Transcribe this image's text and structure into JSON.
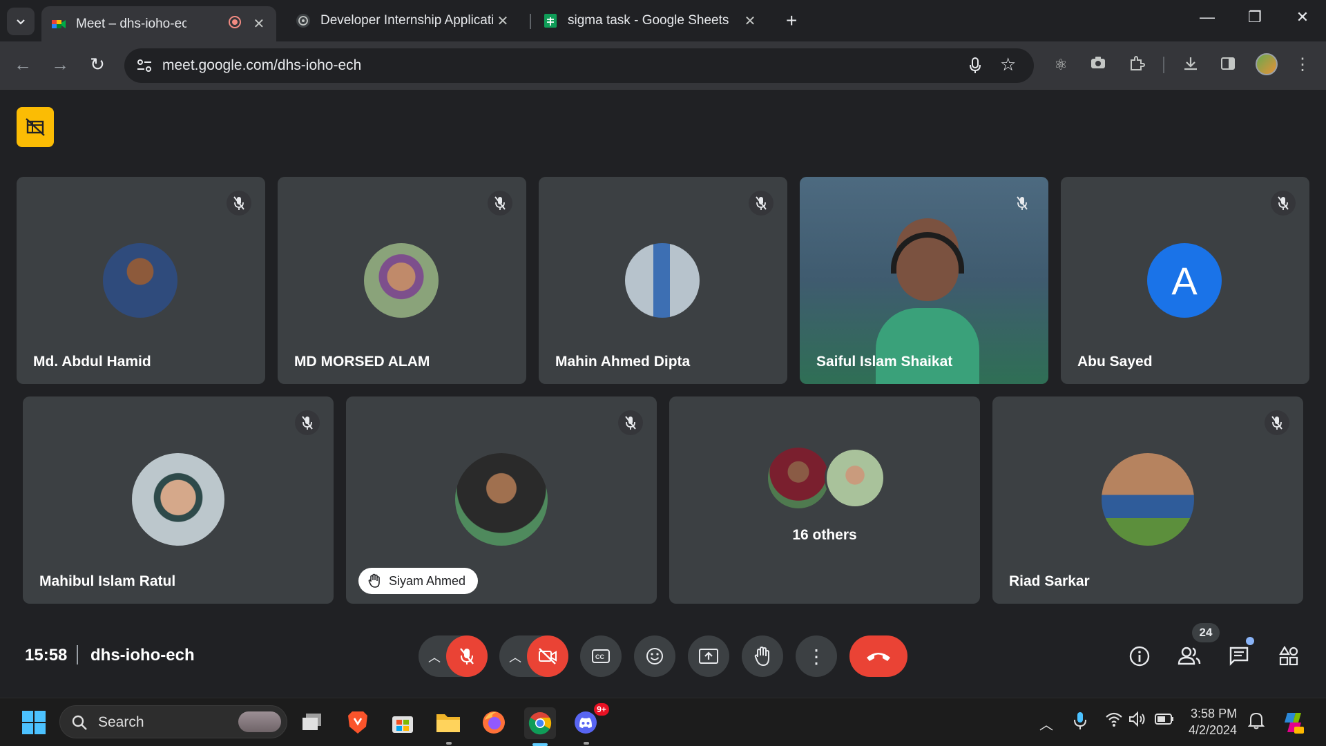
{
  "browser": {
    "tabs": [
      {
        "title": "Meet – dhs-ioho-ech",
        "active": true,
        "favicon": "google-meet-icon"
      },
      {
        "title": "Developer Internship Applicatio",
        "active": false,
        "favicon": "chatgpt-icon"
      },
      {
        "title": "sigma task - Google Sheets",
        "active": false,
        "favicon": "google-sheets-icon"
      }
    ],
    "url": "meet.google.com/dhs-ioho-ech"
  },
  "meet": {
    "participants_row1": [
      {
        "name": "Md. Abdul Hamid",
        "muted": true
      },
      {
        "name": "MD MORSED ALAM",
        "muted": true
      },
      {
        "name": "Mahin Ahmed Dipta",
        "muted": true
      },
      {
        "name": "Saiful Islam Shaikat",
        "muted": true,
        "video": true
      },
      {
        "name": "Abu Sayed",
        "muted": true,
        "initial": "A"
      }
    ],
    "participants_row2": [
      {
        "name": "Mahibul Islam Ratul",
        "muted": true
      },
      {
        "name": "Siyam Ahmed",
        "muted": true,
        "hand_raised": true
      },
      {
        "name": "16 others"
      },
      {
        "name": "Riad Sarkar",
        "muted": true
      }
    ],
    "clock": "15:58",
    "meeting_code": "dhs-ioho-ech",
    "people_count": "24",
    "colors": {
      "end_call": "#ea4335",
      "avatar_a": "#1a73e8",
      "recording": "#fbbc04"
    }
  },
  "taskbar": {
    "search_label": "Search",
    "time": "3:58 PM",
    "date": "4/2/2024",
    "discord_badge": "9+"
  }
}
